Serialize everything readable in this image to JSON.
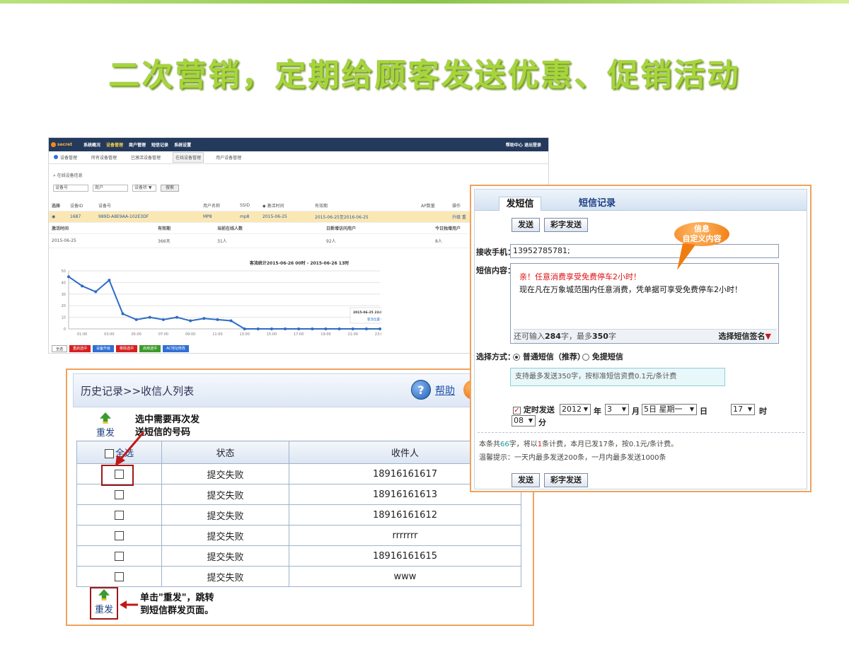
{
  "slide": {
    "title": "二次营销，定期给顾客发送优惠、促销活动"
  },
  "dashboard": {
    "logo": "secret",
    "nav": [
      "系统概况",
      "设备管理",
      "商户管理",
      "短信记录",
      "系统设置"
    ],
    "nav_right": "帮助中心  退出登录",
    "tabs": [
      "设备管理",
      "所有设备管理",
      "已激活设备管理",
      "在线设备管理",
      "用户设备管理"
    ],
    "breadcrumb": "» 在线设备信息",
    "filter": {
      "device_placeholder": "设备号",
      "merchant_placeholder": "商户",
      "status_select": "设备状 ▼",
      "search_button": "搜索"
    },
    "table_headers": [
      "选择",
      "设备ID",
      "设备号",
      "用户名称",
      "SSID",
      "◆ 激活时间",
      "有效期",
      "AP数量",
      "操作"
    ],
    "row": [
      "1687",
      "989D-A8E9AA-102E3DF",
      "MP8",
      "mp8",
      "2015-06-25",
      "2015-06-25至2016-06-25",
      "升级  重"
    ],
    "stats_headers": [
      "激活时间",
      "有效期",
      "当前在线人数",
      "日新增访问用户",
      "今日独增用户"
    ],
    "stats_values": [
      "2015-06-25",
      "366天",
      "31人",
      "92人",
      "8人"
    ],
    "chart_title": "客流统计2015-06-26 00时 - 2015-06-26 13时",
    "chart_tooltip_time": "2015-06-25 23:00",
    "chart_tooltip_value": "客流位置  0",
    "buttons": [
      "全选",
      "重启选中",
      "设备升级",
      "移除选中",
      "启用选中",
      "AC地址修改"
    ]
  },
  "chart_data": {
    "type": "line",
    "title": "客流统计2015-06-26 00时 - 2015-06-26 13时",
    "x": [
      "00:00",
      "01:00",
      "02:00",
      "03:00",
      "04:00",
      "05:00",
      "06:00",
      "07:00",
      "08:00",
      "09:00",
      "10:00",
      "11:00",
      "12:00",
      "13:00",
      "14:00",
      "15:00",
      "16:00",
      "17:00",
      "18:00",
      "19:00",
      "20:00",
      "21:00",
      "22:00",
      "23:00"
    ],
    "x_ticks": [
      "01:00",
      "03:00",
      "05:00",
      "07:00",
      "09:00",
      "11:00",
      "13:00",
      "15:00",
      "17:00",
      "19:00",
      "21:00",
      "23:00"
    ],
    "values": [
      45,
      37,
      32,
      42,
      13,
      8,
      10,
      8,
      10,
      7,
      9,
      8,
      7,
      0,
      0,
      0,
      0,
      0,
      0,
      0,
      0,
      0,
      0,
      0
    ],
    "y_ticks": [
      0,
      10,
      20,
      30,
      40,
      50
    ],
    "ylim": [
      0,
      50
    ],
    "grid": true,
    "color": "#2e6bc4"
  },
  "history": {
    "title": "历史记录>>收信人列表",
    "help_label": "帮助",
    "resend_label": "重发",
    "note_top": [
      "选中需要再次发",
      "送短信的号码"
    ],
    "note_bottom": [
      "单击\"重发\"，跳转",
      "到短信群发页面。"
    ],
    "headers": {
      "select_all": "全选",
      "status": "状态",
      "recipient": "收件人"
    },
    "rows": [
      {
        "status": "提交失败",
        "recipient": "18916161617"
      },
      {
        "status": "提交失败",
        "recipient": "18916161613"
      },
      {
        "status": "提交失败",
        "recipient": "18916161612"
      },
      {
        "status": "提交失败",
        "recipient": "rrrrrrr"
      },
      {
        "status": "提交失败",
        "recipient": "18916161615"
      },
      {
        "status": "提交失败",
        "recipient": "www"
      }
    ]
  },
  "sms": {
    "tabs": {
      "send": "发短信",
      "records": "短信记录"
    },
    "send_button": "发送",
    "mms_button": "彩字发送",
    "bubble": [
      "信息",
      "自定义内容"
    ],
    "phone_label": "接收手机：",
    "phone_value": "13952785781;",
    "content_label": "短信内容：",
    "content_line1": "亲！任意消费享受免费停车2小时！",
    "content_line2": "现在凡在万象城范围内任意消费，凭单据可享受免费停车2小时！",
    "remaining_prefix": "还可输入",
    "remaining_count": "284",
    "remaining_mid": "字，最多",
    "remaining_max": "350",
    "remaining_suffix": "字",
    "signature": "选择短信签名",
    "mode_label": "选择方式：",
    "mode_normal": "普通短信（推荐）",
    "mode_free": "免提短信",
    "tip": "支持最多发送350字，按标准短信资费0.1元/条计费",
    "schedule_label": "定时发送",
    "year": "2012",
    "year_unit": "年",
    "month": "3",
    "month_unit": "月",
    "day": "5日 星期一",
    "day_unit": "日",
    "hour": "17",
    "hour_unit": "时",
    "minute": "08",
    "minute_unit": "分",
    "summary_a": "本条共",
    "summary_count": "66",
    "summary_b": "字，将以",
    "summary_parts": "1",
    "summary_c": "条计费，本月已发17条，按0.1元/条计费。",
    "reminder": "温馨提示：一天内最多发送200条，一月内最多发送1000条"
  }
}
